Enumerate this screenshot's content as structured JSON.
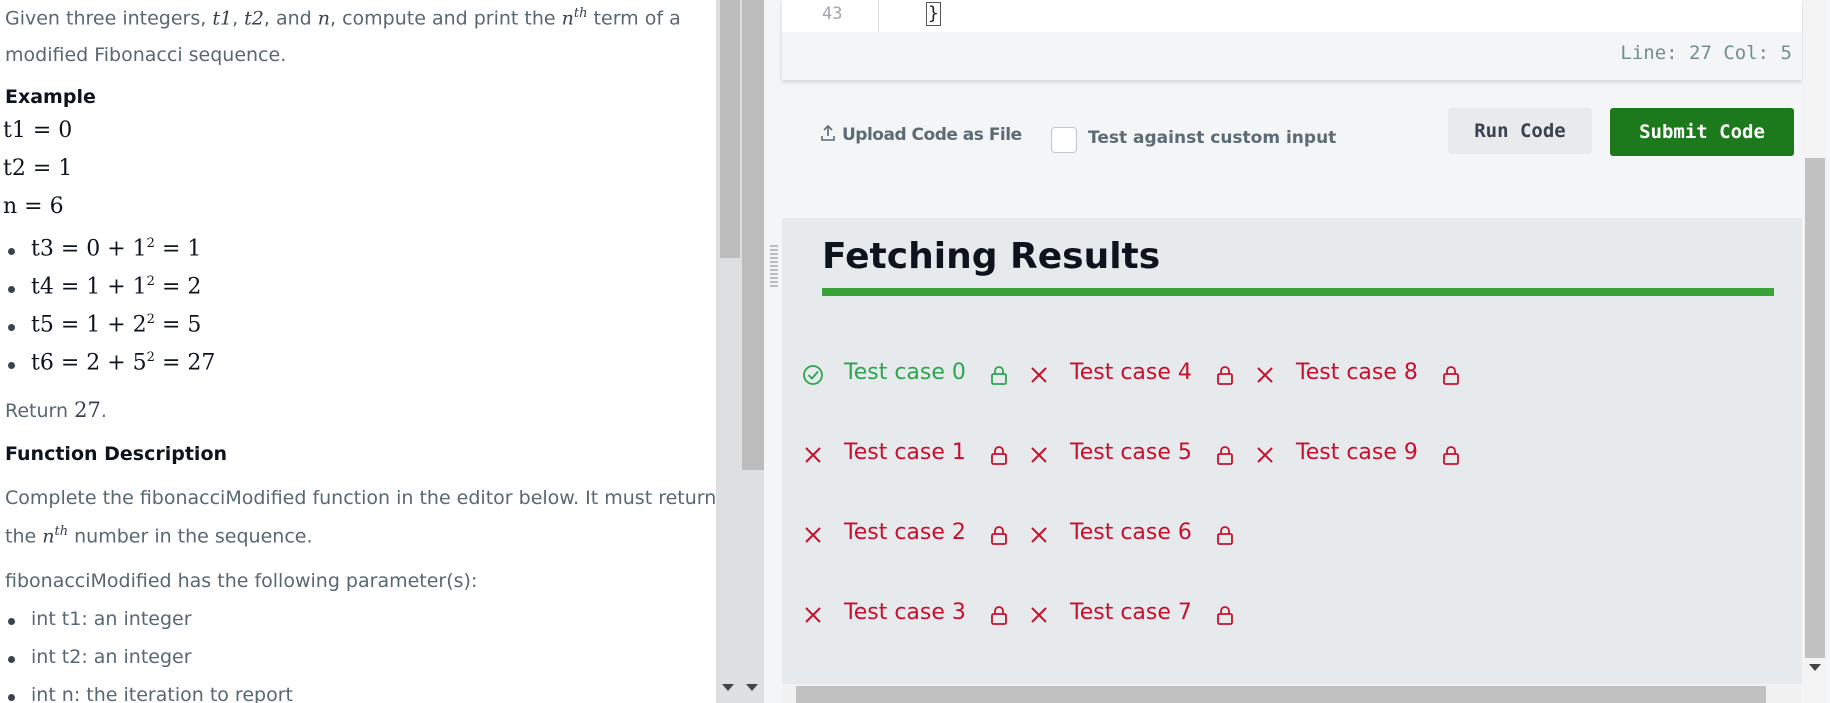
{
  "problem": {
    "intro_pre": "Given three integers, ",
    "intro_t1": "t1",
    "intro_sep1": ", ",
    "intro_t2": "t2",
    "intro_and": ", and ",
    "intro_n": "n",
    "intro_mid": ", compute and print the ",
    "intro_nth_base": "n",
    "intro_nth_sup": "th",
    "intro_post": " term of a",
    "intro_line2": "modified Fibonacci sequence.",
    "example_heading": "Example",
    "example_lines": [
      "t1 = 0",
      "t2 = 1",
      "n = 6"
    ],
    "example_bullets": [
      {
        "lhs": "t3 = 0 + 1",
        "exp": "2",
        "rhs": " = 1"
      },
      {
        "lhs": "t4 = 1 + 1",
        "exp": "2",
        "rhs": " = 2"
      },
      {
        "lhs": "t5 = 1 + 2",
        "exp": "2",
        "rhs": " = 5"
      },
      {
        "lhs": "t6 = 2 + 5",
        "exp": "2",
        "rhs": " = 27"
      }
    ],
    "return_pre": "Return ",
    "return_value": "27",
    "return_post": ".",
    "function_heading": "Function Description",
    "desc_line1": "Complete the fibonacciModified function in the editor below. It must return",
    "desc_line2_pre": "the ",
    "desc_line2_nth_base": "n",
    "desc_line2_nth_sup": "th",
    "desc_line2_post": " number in the sequence.",
    "params_intro": "fibonacciModified has the following parameter(s):",
    "params": [
      "int t1: an integer",
      "int t2: an integer",
      "int n: the iteration to report"
    ]
  },
  "editor": {
    "line_number": "43",
    "code": "}",
    "status": "Line: 27 Col: 5"
  },
  "actions": {
    "upload_label": "Upload Code as File",
    "custom_input_label": "Test against custom input",
    "run_label": "Run Code",
    "submit_label": "Submit Code"
  },
  "results": {
    "title": "Fetching Results",
    "progress": 1.0,
    "test_cases": [
      {
        "label": "Test case 0",
        "status": "pass"
      },
      {
        "label": "Test case 1",
        "status": "fail"
      },
      {
        "label": "Test case 2",
        "status": "fail"
      },
      {
        "label": "Test case 3",
        "status": "fail"
      },
      {
        "label": "Test case 4",
        "status": "fail"
      },
      {
        "label": "Test case 5",
        "status": "fail"
      },
      {
        "label": "Test case 6",
        "status": "fail"
      },
      {
        "label": "Test case 7",
        "status": "fail"
      },
      {
        "label": "Test case 8",
        "status": "fail"
      },
      {
        "label": "Test case 9",
        "status": "fail"
      }
    ]
  },
  "colors": {
    "pass": "#2ea44f",
    "fail": "#c8102e",
    "submit": "#1c7a1c",
    "progress": "#39a33a"
  },
  "icons": {
    "pass": "check-circle-icon",
    "fail": "x-icon",
    "locked": "lock-icon",
    "upload": "upload-icon"
  }
}
